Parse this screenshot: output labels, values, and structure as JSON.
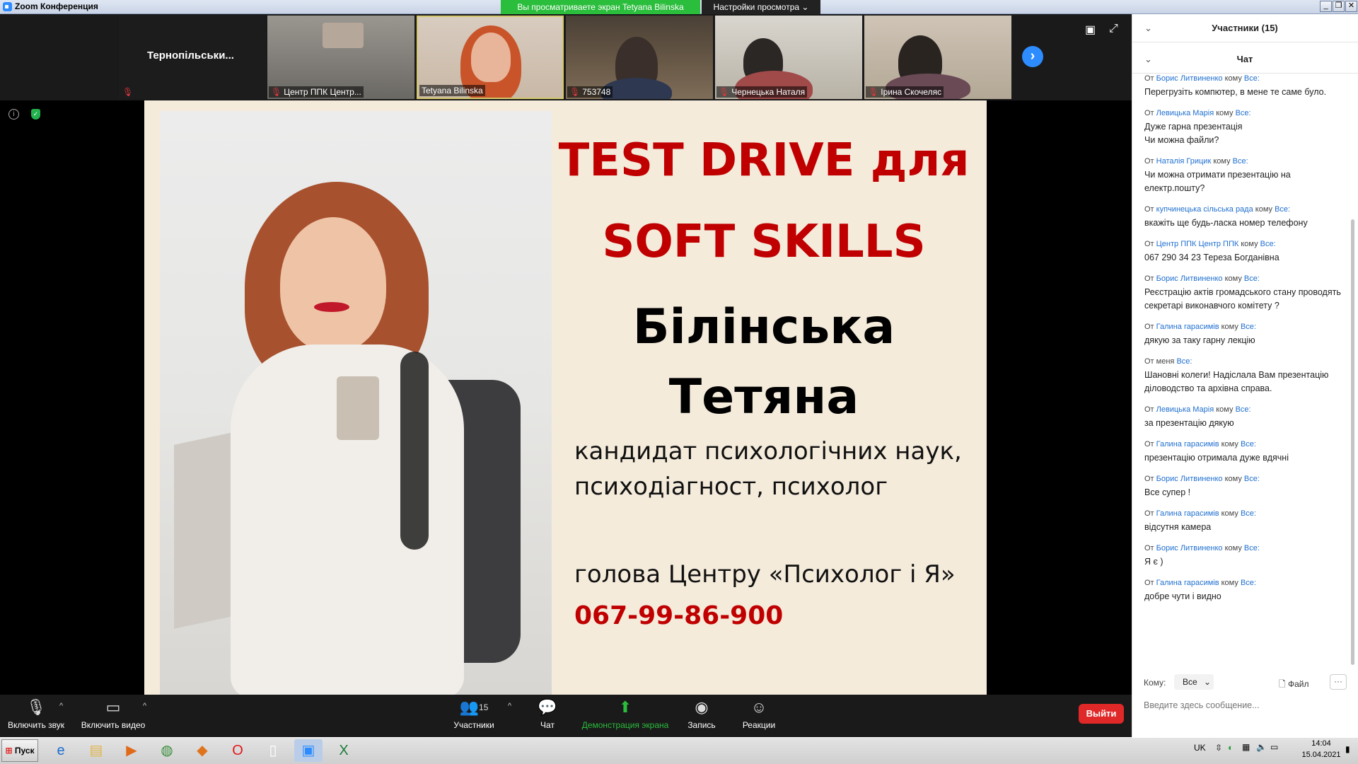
{
  "window": {
    "title": "Zoom Конференция",
    "share_banner": "Вы просматриваете экран Tetyana Bilinska",
    "view_options": "Настройки просмотра",
    "view_options_caret": "⌄"
  },
  "video_strip": {
    "tiles": [
      {
        "name": "Тернопільськи...",
        "muted": true,
        "has_video": false
      },
      {
        "name": "Центр ППК Центр...",
        "muted": true,
        "has_video": true
      },
      {
        "name": "Tetyana Bilinska",
        "muted": false,
        "has_video": true,
        "active_speaker": true
      },
      {
        "name": "753748",
        "muted": true,
        "has_video": true
      },
      {
        "name": "Чернецька Наталя",
        "muted": true,
        "has_video": true
      },
      {
        "name": "Ірина Скочеляс",
        "muted": true,
        "has_video": true
      }
    ],
    "next_icon": "chevron-right-icon"
  },
  "slide": {
    "title_line1": "TEST DRIVE для",
    "title_line2": "SOFT SKILLS",
    "name_line1": "Білінська",
    "name_line2": "Тетяна",
    "desc_line1": "кандидат психологічних наук,",
    "desc_line2": "психодіагност, психолог",
    "desc_line3": "голова Центру «Психолог і Я»",
    "phone": "067-99-86-900",
    "title_color": "#c00000",
    "background_color": "#f4ebdb"
  },
  "toolbar": {
    "audio_label": "Включить звук",
    "video_label": "Включить видео",
    "participants_label": "Участники",
    "participants_count": "15",
    "chat_label": "Чат",
    "share_label": "Демонстрация экрана",
    "record_label": "Запись",
    "reactions_label": "Реакции",
    "leave_label": "Выйти",
    "caret": "^"
  },
  "panel": {
    "participants_header": "Участники (15)",
    "chat_header": "Чат",
    "chevron": "⌄",
    "messages": [
      {
        "from": "Борис Литвиненко",
        "to": "Все:",
        "text": "Перегрузіть компютер, в мене те саме було."
      },
      {
        "from": "Левицька Марія",
        "to": "Все:",
        "text": "Дуже гарна презентація\nЧи можна файли?"
      },
      {
        "from": "Наталія Грицик",
        "to": "Все:",
        "text": "Чи можна отримати презентацію на електр.пошту?"
      },
      {
        "from": "купчинецька сільська рада",
        "to": "Все:",
        "text": "вкажіть ще будь-ласка номер телефону"
      },
      {
        "from": "Центр ППК Центр ППК",
        "to": "Все:",
        "text": "067 290 34 23 Тереза Богданівна"
      },
      {
        "from": "Борис Литвиненко",
        "to": "Все:",
        "text": "Реєстрацію актів громадського стану проводять секретарі виконавчого комітету ?"
      },
      {
        "from": "Галина гарасимів",
        "to": "Все:",
        "text": "дякую за таку гарну лекцію"
      },
      {
        "from": "меня",
        "to": "Все:",
        "text": "Шановні колеги! Надіслала Вам презентацію діловодство та архівна справа.",
        "self": true
      },
      {
        "from": "Левицька Марія",
        "to": "Все:",
        "text": "за презентацію дякую"
      },
      {
        "from": "Галина гарасимів",
        "to": "Все:",
        "text": "презентацію отримала дуже вдячні"
      },
      {
        "from": "Борис Литвиненко",
        "to": "Все:",
        "text": "Все супер !"
      },
      {
        "from": "Галина гарасимів",
        "to": "Все:",
        "text": "відсутня камера"
      },
      {
        "from": "Борис Литвиненко",
        "to": "Все:",
        "text": "Я є )"
      },
      {
        "from": "Галина гарасимів",
        "to": "Все:",
        "text": "добре чути і видно"
      }
    ],
    "from_word": "От",
    "to_word": "кому",
    "to_label": "Кому:",
    "to_value": "Все",
    "file_label": "Файл",
    "more_label": "···",
    "input_placeholder": "Введите здесь сообщение..."
  },
  "taskbar": {
    "start_label": "Пуск",
    "language": "UK",
    "time": "14:04",
    "date": "15.04.2021"
  }
}
